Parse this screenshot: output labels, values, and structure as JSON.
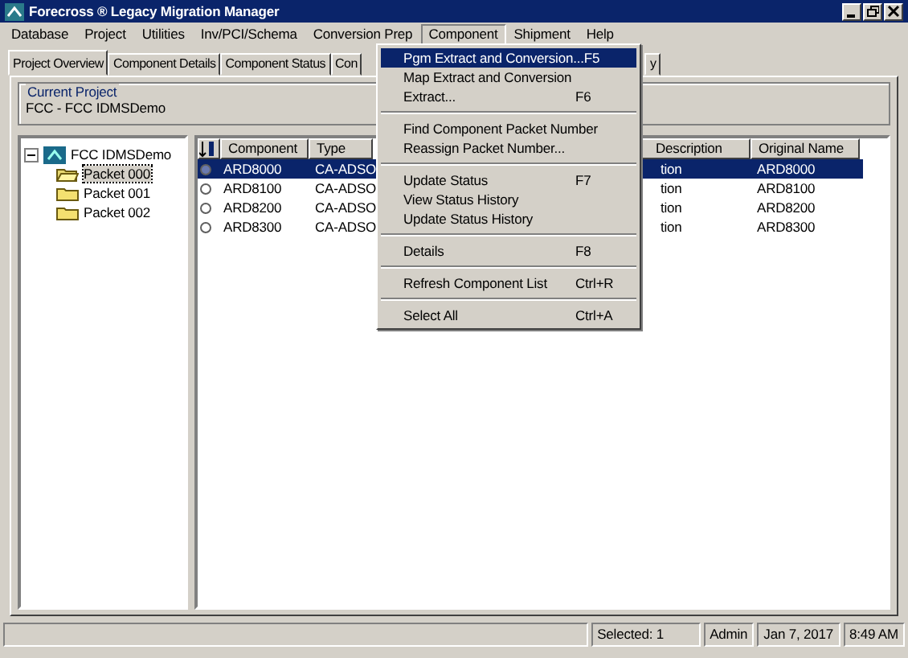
{
  "window": {
    "title": "Forecross ® Legacy Migration Manager"
  },
  "menu_bar": [
    {
      "label": "Database",
      "selected": false
    },
    {
      "label": "Project",
      "selected": false
    },
    {
      "label": "Utilities",
      "selected": false
    },
    {
      "label": "Inv/PCI/Schema",
      "selected": false
    },
    {
      "label": "Conversion Prep",
      "selected": false
    },
    {
      "label": "Component",
      "selected": true
    },
    {
      "label": "Shipment",
      "selected": false
    },
    {
      "label": "Help",
      "selected": false
    }
  ],
  "tabs": [
    {
      "label": "Project Overview",
      "selected": true
    },
    {
      "label": "Component Details",
      "selected": false
    },
    {
      "label": "Component Status",
      "selected": false
    },
    {
      "label": "Con",
      "selected": false
    },
    {
      "label": "y",
      "selected": false
    }
  ],
  "current_project": {
    "legend": "Current Project",
    "value": "FCC - FCC IDMSDemo"
  },
  "tree": {
    "label": "FCC IDMSDemo",
    "expanded": true,
    "children": [
      {
        "label": "Packet 000",
        "selected": true
      },
      {
        "label": "Packet 001",
        "selected": false
      },
      {
        "label": "Packet 002",
        "selected": false
      }
    ]
  },
  "table": {
    "columns": [
      "Component",
      "Type",
      "Description",
      "Original Name"
    ],
    "rows": [
      {
        "selected": true,
        "cells": [
          "ARD8000",
          "CA-ADSO",
          "tion",
          "ARD8000"
        ]
      },
      {
        "selected": false,
        "cells": [
          "ARD8100",
          "CA-ADSO",
          "tion",
          "ARD8100"
        ]
      },
      {
        "selected": false,
        "cells": [
          "ARD8200",
          "CA-ADSO",
          "tion",
          "ARD8200"
        ]
      },
      {
        "selected": false,
        "cells": [
          "ARD8300",
          "CA-ADSO",
          "tion",
          "ARD8300"
        ]
      }
    ]
  },
  "dropdown": [
    {
      "kind": "item",
      "label": "Pgm Extract and Conversion...",
      "shortcut": "F5",
      "selected": true
    },
    {
      "kind": "item",
      "label": "Map Extract and Conversion",
      "selected": false
    },
    {
      "kind": "item",
      "label": "Extract...",
      "shortcut": "F6",
      "selected": false
    },
    {
      "kind": "separator"
    },
    {
      "kind": "item",
      "label": "Find Component Packet Number",
      "selected": false
    },
    {
      "kind": "item",
      "label": "Reassign Packet Number...",
      "selected": false
    },
    {
      "kind": "separator"
    },
    {
      "kind": "item",
      "label": "Update Status",
      "shortcut": "F7",
      "selected": false
    },
    {
      "kind": "item",
      "label": "View Status History",
      "selected": false
    },
    {
      "kind": "item",
      "label": "Update Status History",
      "selected": false
    },
    {
      "kind": "separator"
    },
    {
      "kind": "item",
      "label": "Details",
      "shortcut": "F8",
      "selected": false
    },
    {
      "kind": "separator"
    },
    {
      "kind": "item",
      "label": "Refresh Component List",
      "shortcut": "Ctrl+R",
      "selected": false
    },
    {
      "kind": "separator"
    },
    {
      "kind": "item",
      "label": "Select All",
      "shortcut": "Ctrl+A",
      "selected": false
    }
  ],
  "status_bar": [
    "Selected: 1",
    "Admin",
    "Jan 7, 2017",
    "8:49 AM"
  ]
}
